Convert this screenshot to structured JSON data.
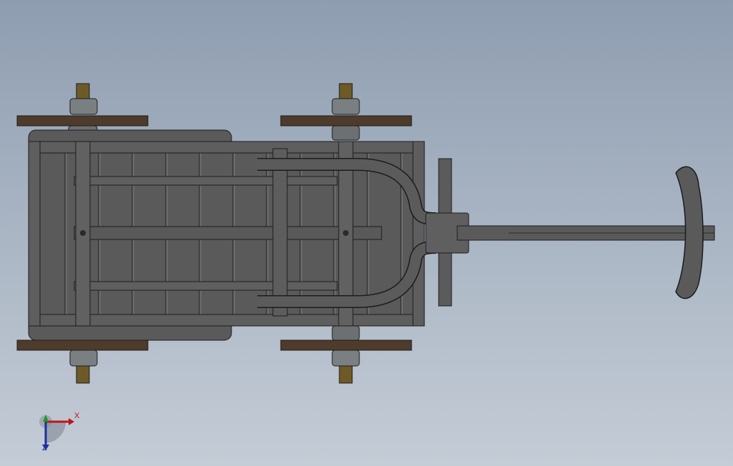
{
  "viewport": {
    "background_top": "#8e9db0",
    "background_bottom": "#c4ccd6"
  },
  "model": {
    "body_color": "#565656",
    "edge_color": "#1c1c1c",
    "wood_color": "#4e3b2c",
    "hub_color": "#7a7f82",
    "axle_tip_color": "#6e5a26"
  },
  "triad": {
    "x_label": "X",
    "z_label": "Z",
    "x_color": "#c0141a",
    "y_color": "#1a9a2a",
    "z_color": "#1a2fa0"
  }
}
